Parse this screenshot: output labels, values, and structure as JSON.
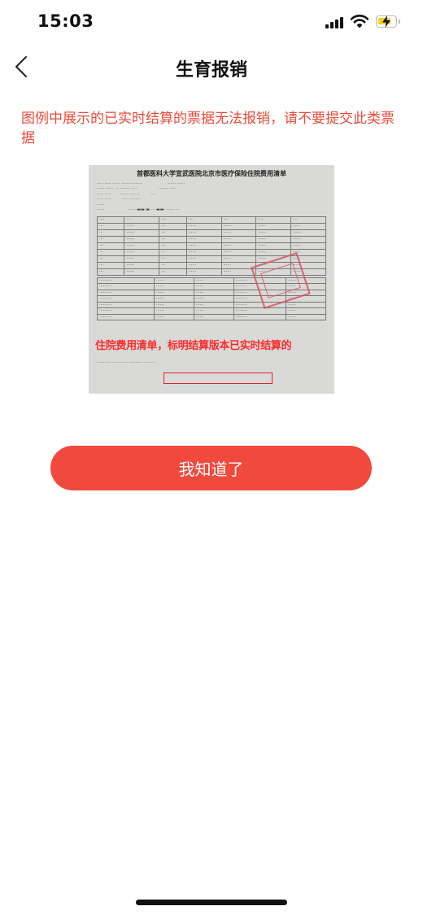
{
  "status_bar": {
    "time": "15:03"
  },
  "nav": {
    "title": "生育报销"
  },
  "warning": {
    "text": "图例中展示的已实时结算的票据无法报销，请不要提交此类票据"
  },
  "receipt": {
    "title": "首都医科大学宣武医院北京市医疗保险住院费用清单",
    "annotation": "住院费用清单，标明结算版本已实时结算的"
  },
  "confirm_button": {
    "label": "我知道了"
  },
  "colors": {
    "accent": "#f0493e",
    "warning_text": "#ea4a3a"
  }
}
